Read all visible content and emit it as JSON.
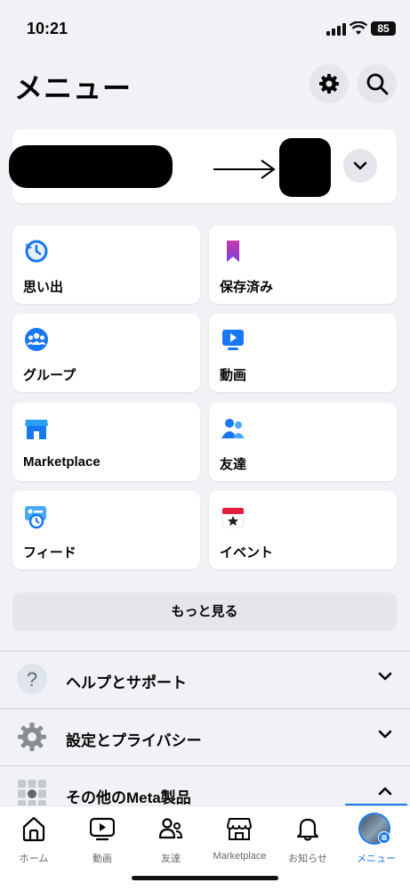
{
  "status_bar": {
    "time": "10:21",
    "battery": "85"
  },
  "header": {
    "title": "メニュー",
    "settings_icon": "gear-icon",
    "search_icon": "search-icon"
  },
  "shortcuts": [
    {
      "label": "思い出",
      "icon": "clock-icon",
      "color": "#1877f2"
    },
    {
      "label": "保存済み",
      "icon": "bookmark-icon",
      "color": "#b83dd6"
    },
    {
      "label": "グループ",
      "icon": "groups-icon",
      "color": "#1877f2"
    },
    {
      "label": "動画",
      "icon": "video-icon",
      "color": "#1877f2"
    },
    {
      "label": "Marketplace",
      "icon": "shop-icon",
      "color": "#1877f2"
    },
    {
      "label": "友達",
      "icon": "friends-icon",
      "color": "#1877f2"
    },
    {
      "label": "フィード",
      "icon": "feed-icon",
      "color": "#1877f2"
    },
    {
      "label": "イベント",
      "icon": "calendar-icon",
      "color": "#e41e3f"
    }
  ],
  "see_more": "もっと見る",
  "sections": [
    {
      "label": "ヘルプとサポート",
      "icon": "help-icon"
    },
    {
      "label": "設定とプライバシー",
      "icon": "gear-icon"
    },
    {
      "label": "その他のMeta製品",
      "icon": "grid-icon"
    }
  ],
  "tabs": [
    {
      "label": "ホーム"
    },
    {
      "label": "動画"
    },
    {
      "label": "友達"
    },
    {
      "label": "Marketplace"
    },
    {
      "label": "お知らせ"
    },
    {
      "label": "メニュー"
    }
  ],
  "accent": "#1877f2"
}
